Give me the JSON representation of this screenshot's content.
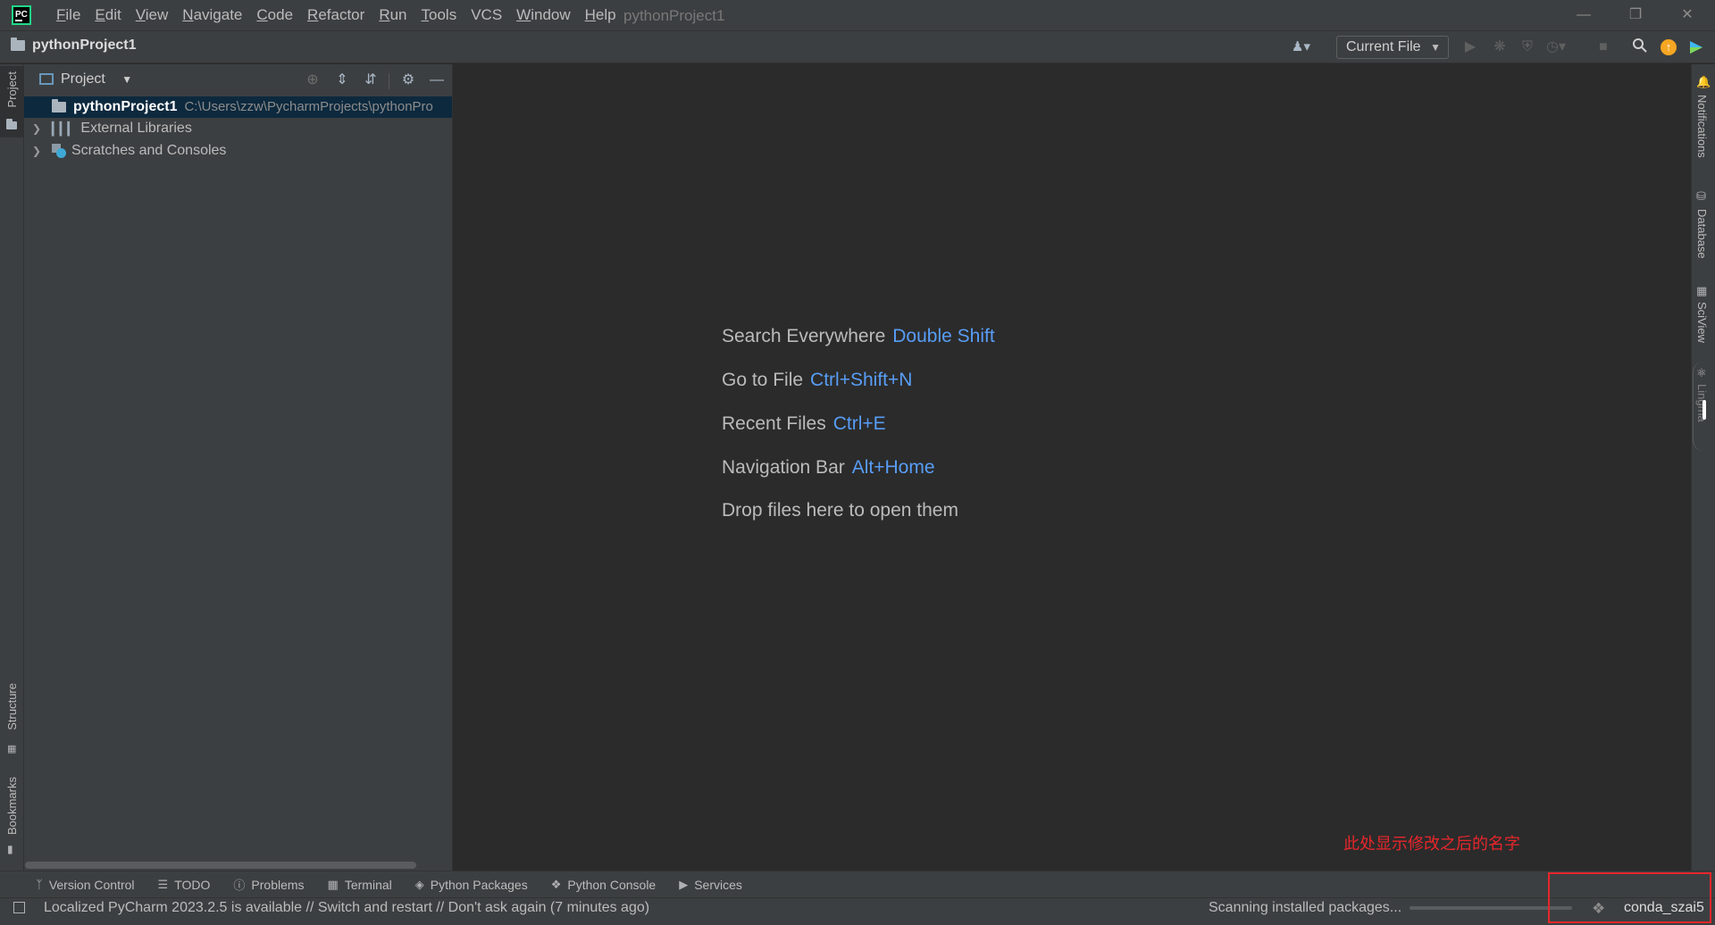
{
  "menu": {
    "items": [
      {
        "mnemonic": "F",
        "rest": "ile"
      },
      {
        "mnemonic": "E",
        "rest": "dit"
      },
      {
        "mnemonic": "V",
        "rest": "iew"
      },
      {
        "mnemonic": "N",
        "rest": "avigate"
      },
      {
        "mnemonic": "C",
        "rest": "ode"
      },
      {
        "mnemonic": "R",
        "rest": "efactor"
      },
      {
        "mnemonic": "R",
        "rest": "un"
      },
      {
        "mnemonic": "T",
        "rest": "ools"
      },
      {
        "mnemonic": "",
        "rest": "VCS"
      },
      {
        "mnemonic": "W",
        "rest": "indow"
      },
      {
        "mnemonic": "H",
        "rest": "elp"
      }
    ]
  },
  "window": {
    "title": "pythonProject1"
  },
  "navbar": {
    "breadcrumb": "pythonProject1",
    "run_config": "Current File"
  },
  "left_stripe": {
    "top_tab": "Project",
    "structure_tab": "Structure",
    "bookmarks_tab": "Bookmarks"
  },
  "project_panel": {
    "title": "Project",
    "tree": [
      {
        "name": "pythonProject1",
        "path": "C:\\Users\\zzw\\PycharmProjects\\pythonPro"
      },
      {
        "name": "External Libraries"
      },
      {
        "name": "Scratches and Consoles"
      }
    ]
  },
  "editor": {
    "hints": [
      {
        "label": "Search Everywhere",
        "key": "Double Shift"
      },
      {
        "label": "Go to File",
        "key": "Ctrl+Shift+N"
      },
      {
        "label": "Recent Files",
        "key": "Ctrl+E"
      },
      {
        "label": "Navigation Bar",
        "key": "Alt+Home"
      },
      {
        "label": "Drop files here to open them",
        "key": ""
      }
    ],
    "annotation": "此处显示修改之后的名字"
  },
  "right_stripe": {
    "tabs": [
      "Notifications",
      "Database",
      "SciView",
      "Lingma"
    ]
  },
  "bottom_tools": [
    "Version Control",
    "TODO",
    "Problems",
    "Terminal",
    "Python Packages",
    "Python Console",
    "Services"
  ],
  "status": {
    "message": "Localized PyCharm 2023.2.5 is available // Switch and restart // Don't ask again (7 minutes ago)",
    "scanning": "Scanning installed packages...",
    "interpreter": "conda_szai5"
  },
  "colors": {
    "accent_key": "#589df6",
    "annotation": "#e8262b",
    "selection": "#0d293e"
  }
}
